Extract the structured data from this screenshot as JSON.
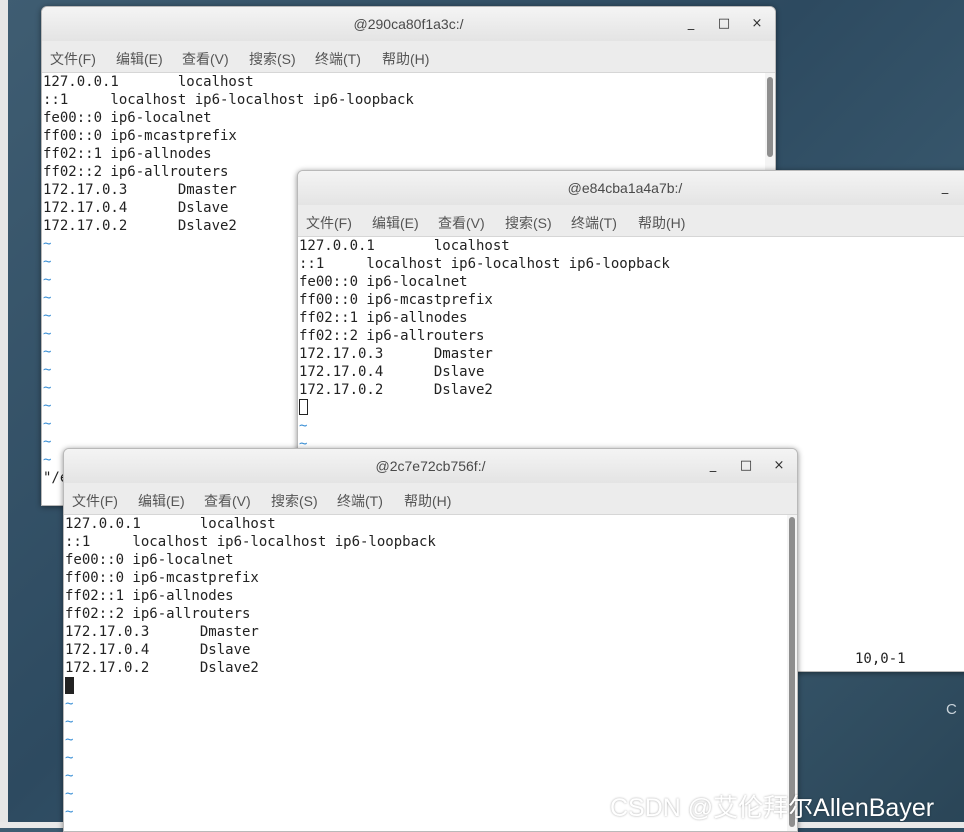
{
  "menu": [
    "文件(F)",
    "编辑(E)",
    "查看(V)",
    "搜索(S)",
    "终端(T)",
    "帮助(H)"
  ],
  "controls": {
    "minimize": "_",
    "maximize": "□",
    "close": "×"
  },
  "hosts_lines": [
    "127.0.0.1       localhost",
    "::1     localhost ip6-localhost ip6-loopback",
    "fe00::0 ip6-localnet",
    "ff00::0 ip6-mcastprefix",
    "ff02::1 ip6-allnodes",
    "ff02::2 ip6-allrouters",
    "172.17.0.3      Dmaster",
    "172.17.0.4      Dslave",
    "172.17.0.2      Dslave2"
  ],
  "tilde": "~",
  "windows": {
    "back": {
      "title": "@290ca80f1a3c:/",
      "command_fragment": "\"/e"
    },
    "middle": {
      "title": "@e84cba1a4a7b:/",
      "status_position": "10,0-1"
    },
    "front": {
      "title": "@2c7e72cb756f:/"
    }
  },
  "desktop": {
    "edge_letter": "C",
    "watermark": "CSDN @艾伦拜尔AllenBayer"
  }
}
